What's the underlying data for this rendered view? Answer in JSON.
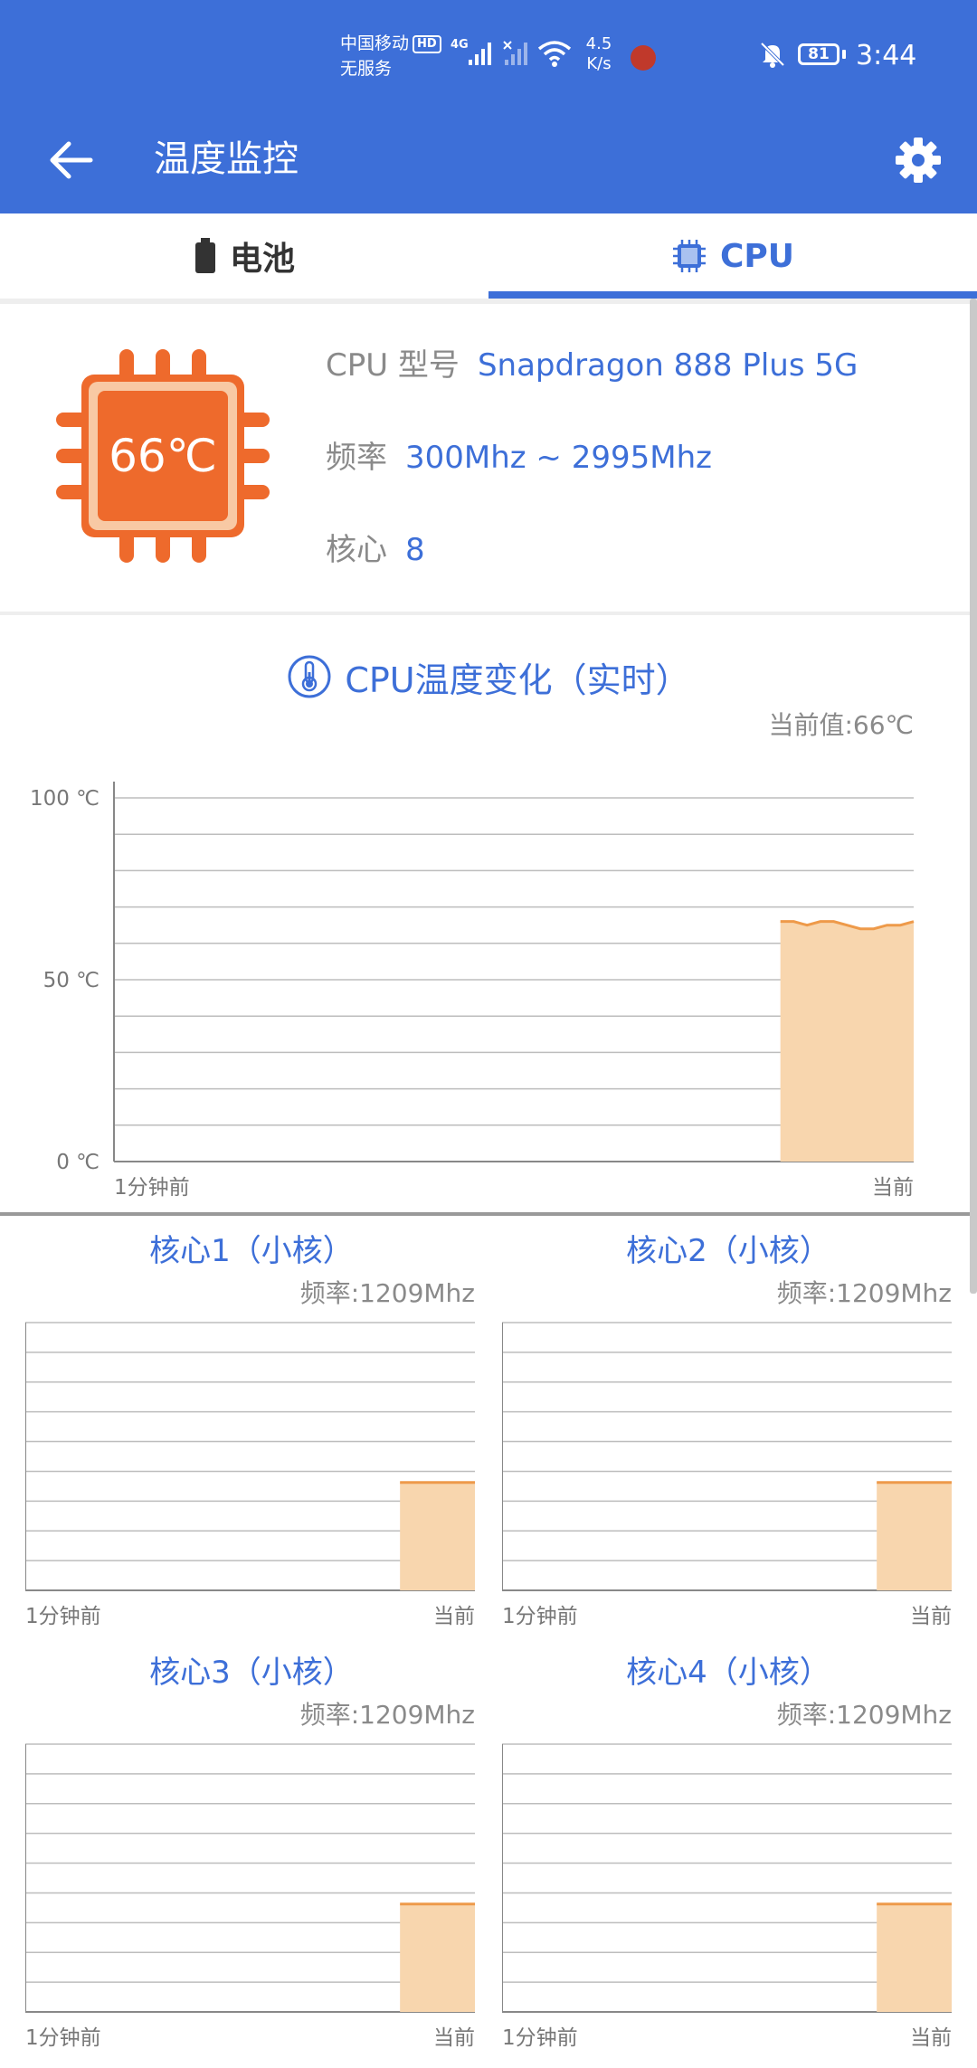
{
  "status_bar": {
    "carrier_line1": "中国移动",
    "carrier_hd": "HD",
    "carrier_line2": "无服务",
    "network_type": "4G",
    "speed_value": "4.5",
    "speed_unit": "K/s",
    "battery_level": "81",
    "time": "3:44"
  },
  "toolbar": {
    "title": "温度监控",
    "back_icon": "arrow-left-icon",
    "settings_icon": "gear-icon"
  },
  "tabs": [
    {
      "label": "电池",
      "icon": "battery-icon",
      "active": false
    },
    {
      "label": "CPU",
      "icon": "cpu-chip-icon",
      "active": true
    }
  ],
  "cpu_info": {
    "temperature": "66℃",
    "model_label": "CPU 型号",
    "model_value": "Snapdragon 888 Plus 5G",
    "freq_label": "频率",
    "freq_value": "300Mhz ~ 2995Mhz",
    "cores_label": "核心",
    "cores_value": "8"
  },
  "main_chart": {
    "title": "CPU温度变化（实时）",
    "current_value": "当前值:66℃"
  },
  "colors": {
    "primary": "#3d6fd8",
    "chip_orange": "#ee6a2c",
    "chip_light": "#f8c9a4",
    "fill": "#f8d6ae",
    "stroke": "#ee9a4a"
  },
  "chart_data": [
    {
      "type": "area",
      "title": "CPU温度变化（实时）",
      "y_tick_labels": [
        "100 ℃",
        "50 ℃",
        "0 ℃"
      ],
      "x_tick_labels": [
        "1分钟前",
        "当前"
      ],
      "ylim": [
        0,
        100
      ],
      "y_gridlines": [
        0,
        10,
        20,
        30,
        40,
        50,
        60,
        70,
        80,
        90,
        100
      ],
      "x_range_seconds": [
        0,
        60
      ],
      "series": [
        {
          "x": [
            50,
            51,
            52,
            53,
            54,
            55,
            56,
            57,
            58,
            59,
            60
          ],
          "values": [
            66,
            66,
            65,
            66,
            66,
            65,
            64,
            64,
            65,
            65,
            66
          ]
        }
      ]
    },
    {
      "type": "area",
      "title": "核心1（小核）",
      "subtitle": "频率:1209Mhz",
      "x_tick_labels": [
        "1分钟前",
        "当前"
      ],
      "ylim": [
        0,
        3000
      ],
      "x_range_seconds": [
        0,
        60
      ],
      "series": [
        {
          "x": [
            50,
            60
          ],
          "values": [
            1209,
            1209
          ]
        }
      ]
    },
    {
      "type": "area",
      "title": "核心2（小核）",
      "subtitle": "频率:1209Mhz",
      "x_tick_labels": [
        "1分钟前",
        "当前"
      ],
      "ylim": [
        0,
        3000
      ],
      "x_range_seconds": [
        0,
        60
      ],
      "series": [
        {
          "x": [
            50,
            60
          ],
          "values": [
            1209,
            1209
          ]
        }
      ]
    },
    {
      "type": "area",
      "title": "核心3（小核）",
      "subtitle": "频率:1209Mhz",
      "x_tick_labels": [
        "1分钟前",
        "当前"
      ],
      "ylim": [
        0,
        3000
      ],
      "x_range_seconds": [
        0,
        60
      ],
      "series": [
        {
          "x": [
            50,
            60
          ],
          "values": [
            1209,
            1209
          ]
        }
      ]
    },
    {
      "type": "area",
      "title": "核心4（小核）",
      "subtitle": "频率:1209Mhz",
      "x_tick_labels": [
        "1分钟前",
        "当前"
      ],
      "ylim": [
        0,
        3000
      ],
      "x_range_seconds": [
        0,
        60
      ],
      "series": [
        {
          "x": [
            50,
            60
          ],
          "values": [
            1209,
            1209
          ]
        }
      ]
    }
  ]
}
